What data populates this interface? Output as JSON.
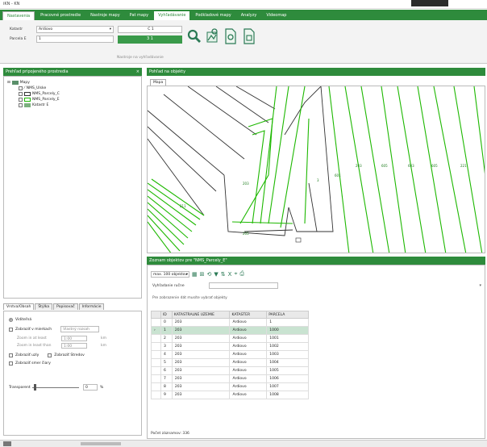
{
  "app": {
    "title": "iKN - KN"
  },
  "tabs": [
    "Nastavenia",
    "Pracovné prostredie",
    "Nastroje mapy",
    "Pat mapy",
    "Vyhľadávanie",
    "Podkladové mapy",
    "Analyzy",
    "Videomap"
  ],
  "ribbon": {
    "katastr_label": "Katastr",
    "katastr_value": "Ardiovo",
    "parcela_label": "Parcela E",
    "parcela_value": "1",
    "box1_value": "C 1",
    "box2_value": "3 1",
    "group_label": "Nastroje na vyhľadávanie"
  },
  "tree": {
    "header": "Prehľad pripojeného prostredia",
    "items": [
      {
        "label": "Mapy",
        "level": 0
      },
      {
        "label": "NMS_Ulske",
        "level": 1
      },
      {
        "label": "NMS_Parcely_C",
        "level": 1
      },
      {
        "label": "NMS_Parcely_E",
        "level": 1
      },
      {
        "label": "Katastr E",
        "level": 1
      }
    ]
  },
  "props": {
    "tabs": [
      "Vrstva/Obsah",
      "Štýlka",
      "Popisovač",
      "Informácie"
    ],
    "viditelnost": "Viditeľná",
    "zobrazit_mierku": "Zobraziť v mierkach",
    "mierka_select": "Vlastný rozsah",
    "zoom_in_label": "Zoom in at least",
    "zoom_out_label": "Zoom in least than",
    "zoom_in_val": "1:00",
    "zoom_out_val": "1:00",
    "unit1": "km",
    "unit2": "km",
    "uzly": "Zobraziť uzly",
    "stredy": "Zobraziť Stredov",
    "smer": "Zobraziť smer čiary",
    "transparent_label": "Transparent",
    "transparent_value": "0",
    "transparent_pct": "%"
  },
  "map": {
    "header": "Pohľad na objekty",
    "tab": "Mapa",
    "parcels": [
      "203",
      "205",
      "3",
      "601",
      "203",
      "605",
      "603",
      "605",
      "221",
      "211"
    ]
  },
  "zoznam": {
    "header": "Zoznam objektov pre \"NMS_Parcely_E\"",
    "toolbar_select": "max. 100 objektov",
    "search_label": "Vyhľadanie ručne",
    "info": "Pre zobrazenie dát musíte vybrať objekty",
    "columns": [
      "ID",
      "CISLO",
      "KATASTRALNE UZEMIE",
      "KATASTER",
      "PARCELA"
    ],
    "rows": [
      [
        "",
        "0",
        "203",
        "Ardiovo",
        "1"
      ],
      [
        "›",
        "1",
        "203",
        "Ardiovo",
        "1000"
      ],
      [
        "",
        "2",
        "203",
        "Ardiovo",
        "1001"
      ],
      [
        "",
        "3",
        "203",
        "Ardiovo",
        "1002"
      ],
      [
        "",
        "4",
        "203",
        "Ardiovo",
        "1003"
      ],
      [
        "",
        "5",
        "203",
        "Ardiovo",
        "1004"
      ],
      [
        "",
        "6",
        "203",
        "Ardiovo",
        "1005"
      ],
      [
        "",
        "7",
        "203",
        "Ardiovo",
        "1006"
      ],
      [
        "",
        "8",
        "203",
        "Ardiovo",
        "1007"
      ],
      [
        "",
        "9",
        "203",
        "Ardiovo",
        "1008"
      ]
    ],
    "footer": "Počet záznamov: 336"
  },
  "colors": {
    "accent": "#2e8b3c",
    "map_line": "#1db800",
    "selected_row": "#c9e3d1"
  }
}
